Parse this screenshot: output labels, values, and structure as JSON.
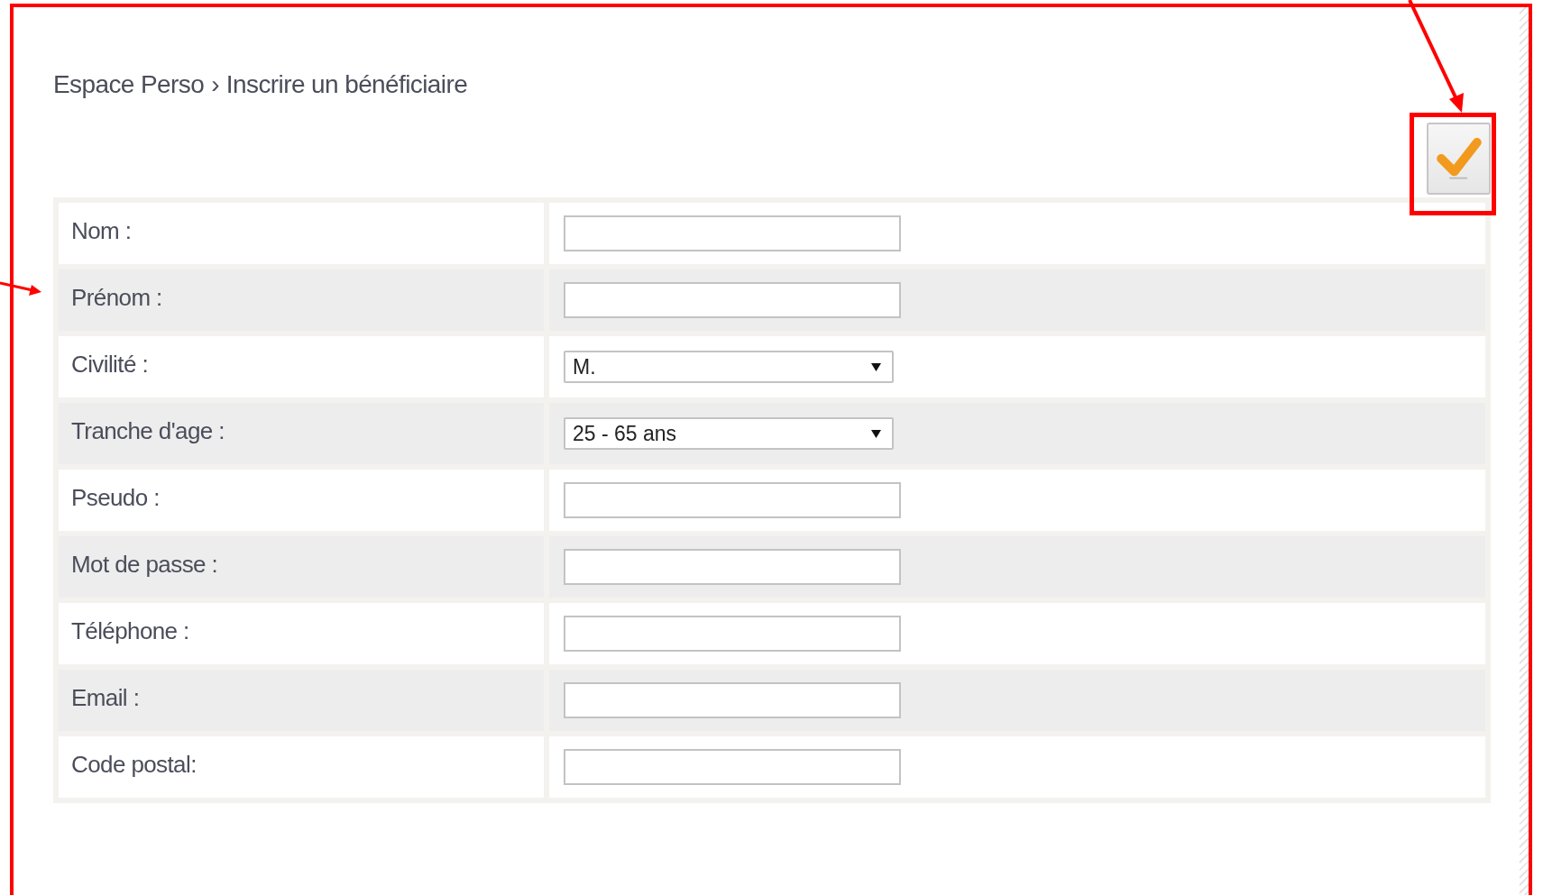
{
  "breadcrumb": {
    "items": [
      "Espace Perso",
      "Inscrire un bénéficiaire"
    ],
    "separator": "›"
  },
  "fields": [
    {
      "label": "Nom :",
      "kind": "text"
    },
    {
      "label": "Prénom :",
      "kind": "text"
    },
    {
      "label": "Civilité :",
      "kind": "select",
      "value": "M."
    },
    {
      "label": "Tranche d'age :",
      "kind": "select",
      "value": "25 - 65 ans"
    },
    {
      "label": "Pseudo :",
      "kind": "text"
    },
    {
      "label": "Mot de passe :",
      "kind": "text"
    },
    {
      "label": "Téléphone :",
      "kind": "text"
    },
    {
      "label": "Email :",
      "kind": "text"
    },
    {
      "label": "Code postal:",
      "kind": "text"
    }
  ]
}
